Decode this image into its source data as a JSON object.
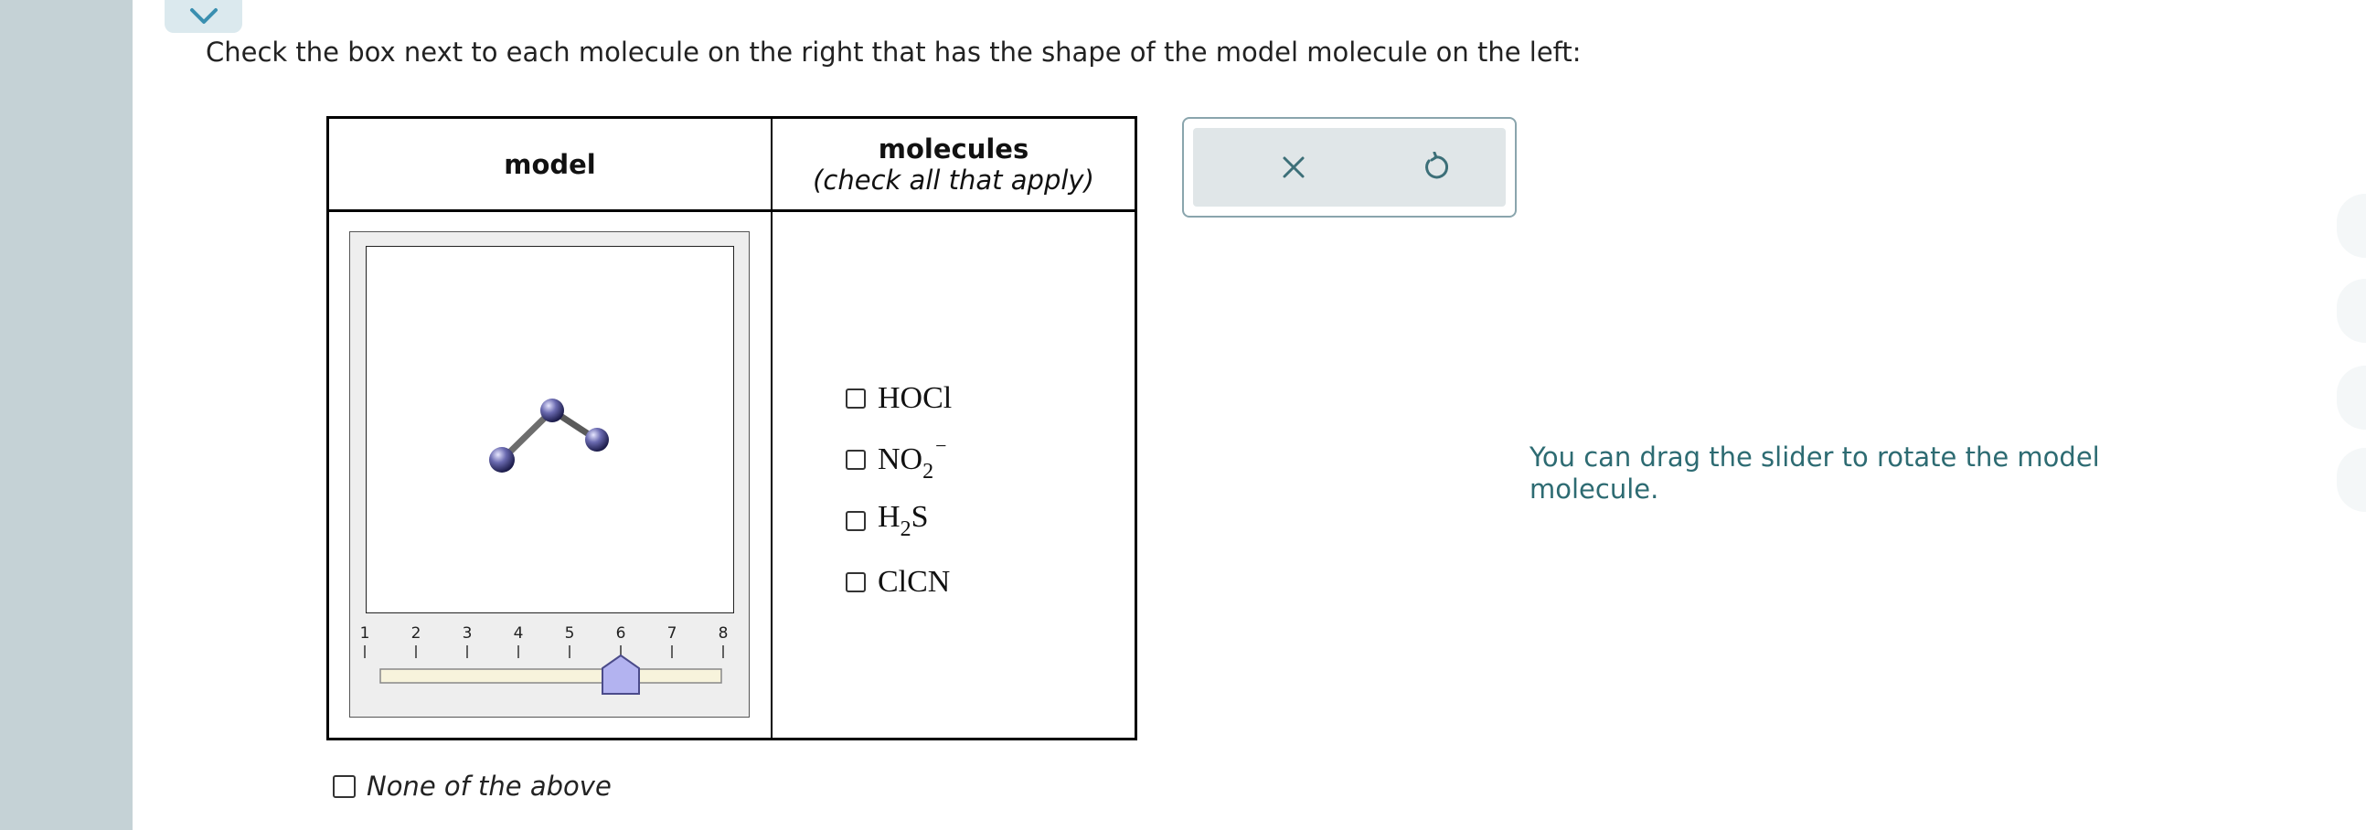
{
  "collapse_icon": "chevron-down-icon",
  "question": {
    "prompt": "Check the box next to each molecule on the right that has the shape of the model molecule on the left:"
  },
  "table": {
    "model_header": "model",
    "molecules_header": "molecules",
    "molecules_subheader": "(check all that apply)"
  },
  "slider": {
    "ticks": [
      "1",
      "2",
      "3",
      "4",
      "5",
      "6",
      "7",
      "8"
    ],
    "value": 6
  },
  "molecules": [
    {
      "base": "HOCl",
      "sub": "",
      "tail": "",
      "sup": "",
      "checked": false
    },
    {
      "base": "NO",
      "sub": "2",
      "tail": "",
      "sup": "−",
      "checked": false
    },
    {
      "base": "H",
      "sub": "2",
      "tail": "S",
      "sup": "",
      "checked": false
    },
    {
      "base": "ClCN",
      "sub": "",
      "tail": "",
      "sup": "",
      "checked": false
    }
  ],
  "none_option": {
    "label": "None of the above",
    "checked": false
  },
  "actions": {
    "clear_icon": "close-icon",
    "undo_icon": "undo-icon"
  },
  "hint": "You can drag the slider to rotate the model molecule.",
  "colors": {
    "accent": "#2d6b72",
    "atom": "#6a6ab0",
    "slider_thumb": "#b3b3f0",
    "rail": "#c5d2d6"
  }
}
